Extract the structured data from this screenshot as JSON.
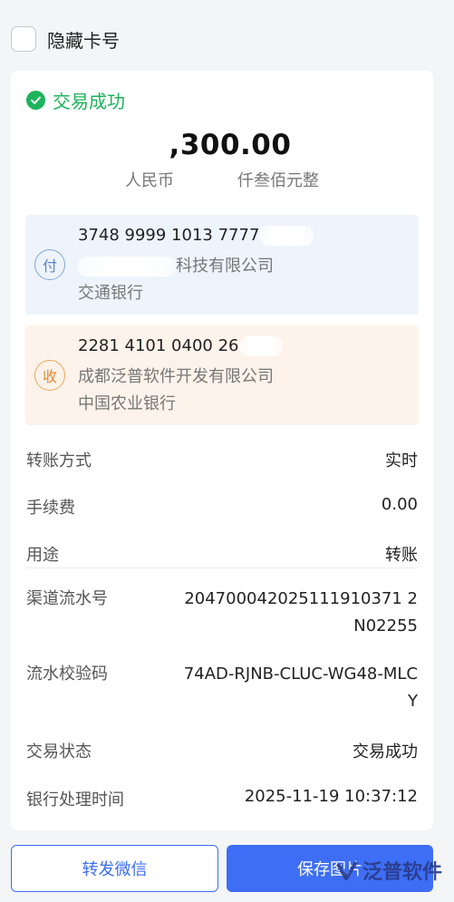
{
  "hide_card": {
    "label": "隐藏卡号",
    "checked": false
  },
  "receipt": {
    "status": "交易成功",
    "amount": ",300.00",
    "amount_words_prefix": "人民币",
    "amount_words_suffix": "仟叁佰元整",
    "payer": {
      "badge": "付",
      "account": "3748 9999 1013 7777",
      "name_suffix": "科技有限公司",
      "bank": "交通银行"
    },
    "payee": {
      "badge": "收",
      "account": "2281 4101 0400 26",
      "name": "成都泛普软件开发有限公司",
      "bank": "中国农业银行"
    },
    "details": [
      {
        "label": "转账方式",
        "value": "实时"
      },
      {
        "label": "手续费",
        "value": "0.00"
      },
      {
        "label": "用途",
        "value": "转账"
      },
      {
        "label": "渠道流水号",
        "value": "204700042025111910371 2N02255"
      },
      {
        "label": "流水校验码",
        "value": "74AD-RJNB-CLUC-WG48-MLCY"
      },
      {
        "label": "交易状态",
        "value": "交易成功"
      },
      {
        "label": "银行处理时间",
        "value": "2025-11-19 10:37:12"
      }
    ]
  },
  "buttons": {
    "forward": "转发微信",
    "save": "保存图片"
  },
  "watermark": {
    "text": "泛普软件"
  },
  "colors": {
    "primary": "#3d6ef5",
    "success": "#1db35b",
    "payer_bg": "#eef4fc",
    "payee_bg": "#fdf3ea"
  },
  "icons": {
    "status": "check-circle-icon"
  }
}
